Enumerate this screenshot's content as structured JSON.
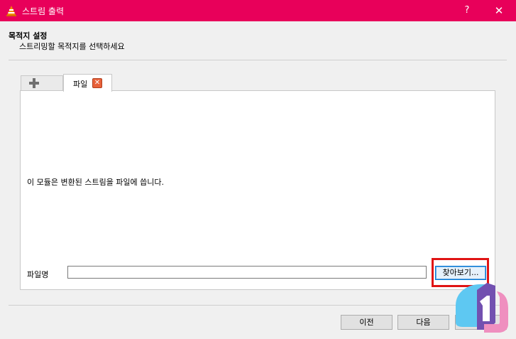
{
  "window": {
    "title": "스트림 출력",
    "help_label": "?",
    "close_label": "✕",
    "icon": "vlc-cone-icon"
  },
  "header": {
    "title": "목적지 설정",
    "subtitle": "스트리밍할 목적지를 선택하세요"
  },
  "tabs": {
    "add_icon": "plus-icon",
    "file_label": "파일",
    "file_close_icon": "close-icon"
  },
  "panel": {
    "description": "이 모듈은 변환된 스트림을 파일에 씁니다.",
    "filename_label": "파일명",
    "filename_value": "",
    "browse_label": "찾아보기..."
  },
  "footer": {
    "prev_label": "이전",
    "next_label": "다음"
  },
  "colors": {
    "titlebar": "#e8005a",
    "highlight": "#e01414"
  }
}
